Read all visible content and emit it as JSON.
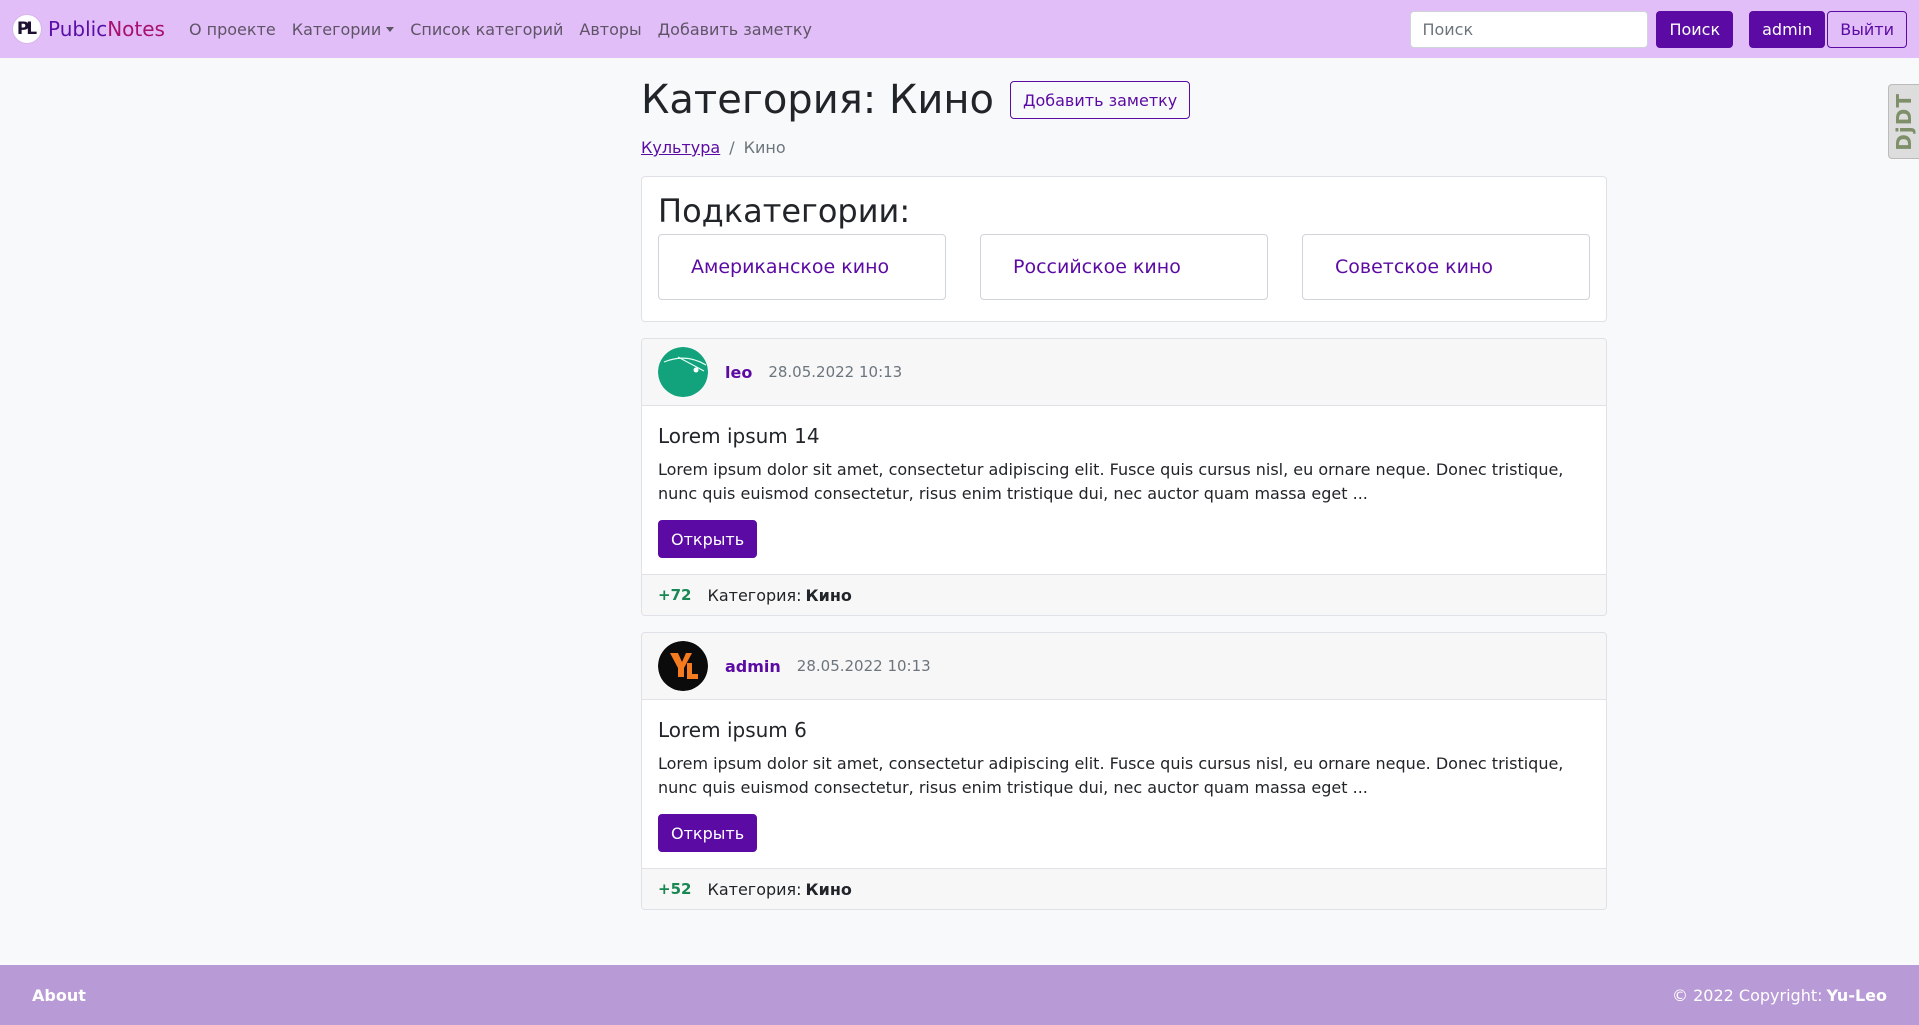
{
  "navbar": {
    "brand_logo": "PL",
    "brand_part1": "Public",
    "brand_part2": "Notes",
    "links": {
      "about": "О проекте",
      "categories": "Категории",
      "categories_list": "Список категорий",
      "authors": "Авторы",
      "add_note": "Добавить заметку"
    },
    "search_placeholder": "Поиск",
    "search_value": "",
    "search_button": "Поиск",
    "user_button": "admin",
    "logout_button": "Выйти",
    "colors": {
      "background": "#e1bef7",
      "accent": "#5b0aa4"
    }
  },
  "debug_toolbar": {
    "label": "DjDT"
  },
  "page": {
    "title": "Категория: Кино",
    "add_note_button": "Добавить заметку",
    "breadcrumb": {
      "parent": "Культура",
      "separator": "/",
      "current": "Кино"
    }
  },
  "subcategories": {
    "title": "Подкатегории:",
    "items": [
      {
        "label": "Американское кино"
      },
      {
        "label": "Российское кино"
      },
      {
        "label": "Советское кино"
      }
    ]
  },
  "posts": [
    {
      "author": "leo",
      "avatar_icon": "globe-avatar-icon",
      "date": "28.05.2022 10:13",
      "title": "Lorem ipsum 14",
      "text": "Lorem ipsum dolor sit amet, consectetur adipiscing elit. Fusce quis cursus nisl, eu ornare neque. Donec tristique, nunc quis euismod consectetur, risus enim tristique dui, nec auctor quam massa eget ...",
      "open_button": "Открыть",
      "rating": "+72",
      "category_label": "Категория:",
      "category_name": "Кино"
    },
    {
      "author": "admin",
      "avatar_icon": "yl-logo-avatar-icon",
      "date": "28.05.2022 10:13",
      "title": "Lorem ipsum 6",
      "text": "Lorem ipsum dolor sit amet, consectetur adipiscing elit. Fusce quis cursus nisl, eu ornare neque. Donec tristique, nunc quis euismod consectetur, risus enim tristique dui, nec auctor quam massa eget ...",
      "open_button": "Открыть",
      "rating": "+52",
      "category_label": "Категория:",
      "category_name": "Кино"
    }
  ],
  "footer": {
    "about": "About",
    "copyright": "© 2022 Copyright:",
    "owner": "Yu-Leo",
    "colors": {
      "background": "#b89ad6"
    }
  }
}
